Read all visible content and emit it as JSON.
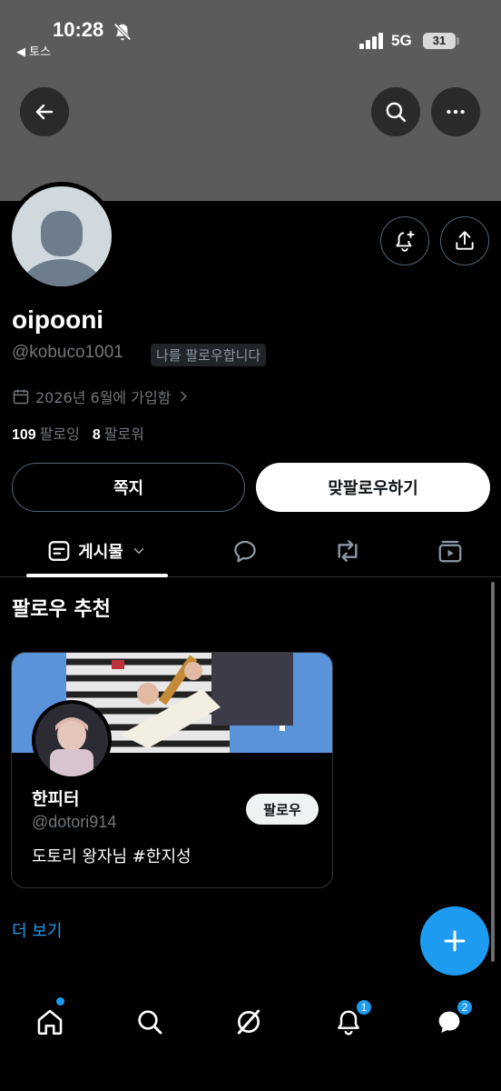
{
  "status_bar": {
    "time": "10:28",
    "back_app": "◀ 토스",
    "network": "5G",
    "battery": "31"
  },
  "profile": {
    "display_name": "oipooni",
    "handle": "@kobuco1001",
    "follows_you": "나를 팔로우합니다",
    "joined": "2026년 6월에 가입함",
    "following_count": "109",
    "following_label": "팔로잉",
    "followers_count": "8",
    "followers_label": "팔로워"
  },
  "actions": {
    "dm_label": "쪽지",
    "follow_back_label": "맞팔로우하기"
  },
  "tabs": {
    "posts_label": "게시물"
  },
  "suggestions": {
    "title": "팔로우 추천",
    "card": {
      "name": "한피터",
      "handle": "@dotori914",
      "bio": "도토리 왕자님 #한지성",
      "follow_label": "팔로우"
    },
    "more_label": "더 보기"
  },
  "bottom_nav": {
    "notifications_badge": "1",
    "messages_badge": "2"
  },
  "colors": {
    "accent": "#1d9bf0",
    "banner": "#5b5b5b",
    "background": "#000000"
  },
  "icons": [
    "back-icon",
    "search-icon",
    "more-icon",
    "bell-plus-icon",
    "share-icon",
    "calendar-icon",
    "posts-icon",
    "chevron-down-icon",
    "reply-icon",
    "repost-icon",
    "media-icon",
    "plus-icon",
    "home-icon",
    "grok-icon",
    "bell-icon",
    "messages-icon"
  ]
}
